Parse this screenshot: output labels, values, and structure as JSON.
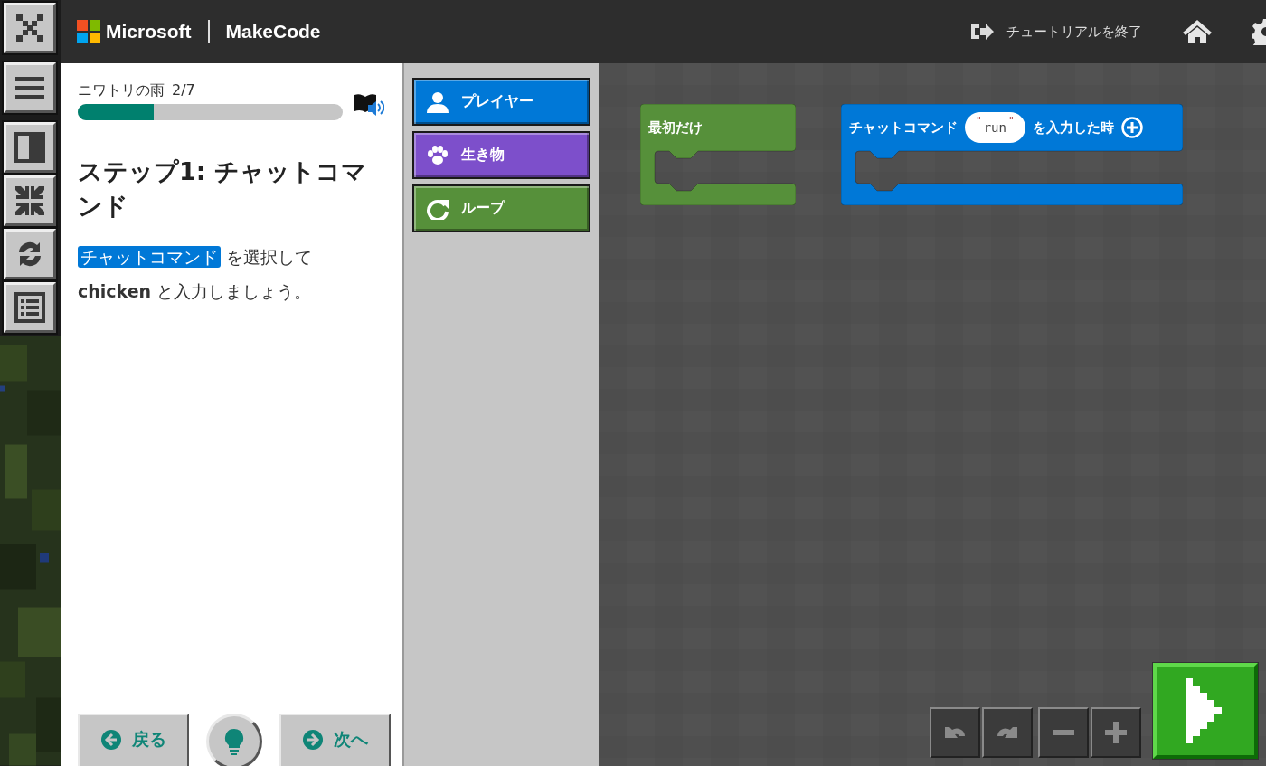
{
  "header": {
    "brand": "Microsoft",
    "product": "MakeCode",
    "exit_label": "チュートリアルを終了"
  },
  "tutorial": {
    "title": "ニワトリの雨",
    "step_count": "2/7",
    "level": 0.286,
    "heading": "ステップ1: チャットコマンド",
    "block_ref": "チャットコマンド",
    "line_1": "を選択して",
    "line_2": "**chicken** と入力しましょう。",
    "back_label": "戻る",
    "next_label": "次へ"
  },
  "toolbox": [
    {
      "label": "プレイヤー",
      "color": "#0078d7"
    },
    {
      "label": "生き物",
      "color": "#7d4fcb"
    },
    {
      "label": "ループ",
      "color": "#56903a"
    }
  ],
  "blocks": [
    {
      "kind": "start",
      "label": "最初だけ",
      "color": "#56903a"
    },
    {
      "kind": "chat",
      "label": "チャットコマンド",
      "quote_open": "\"",
      "value": "run",
      "quote_close": "\"",
      "label_after": "を入力した時",
      "color": "#0078d7"
    }
  ]
}
